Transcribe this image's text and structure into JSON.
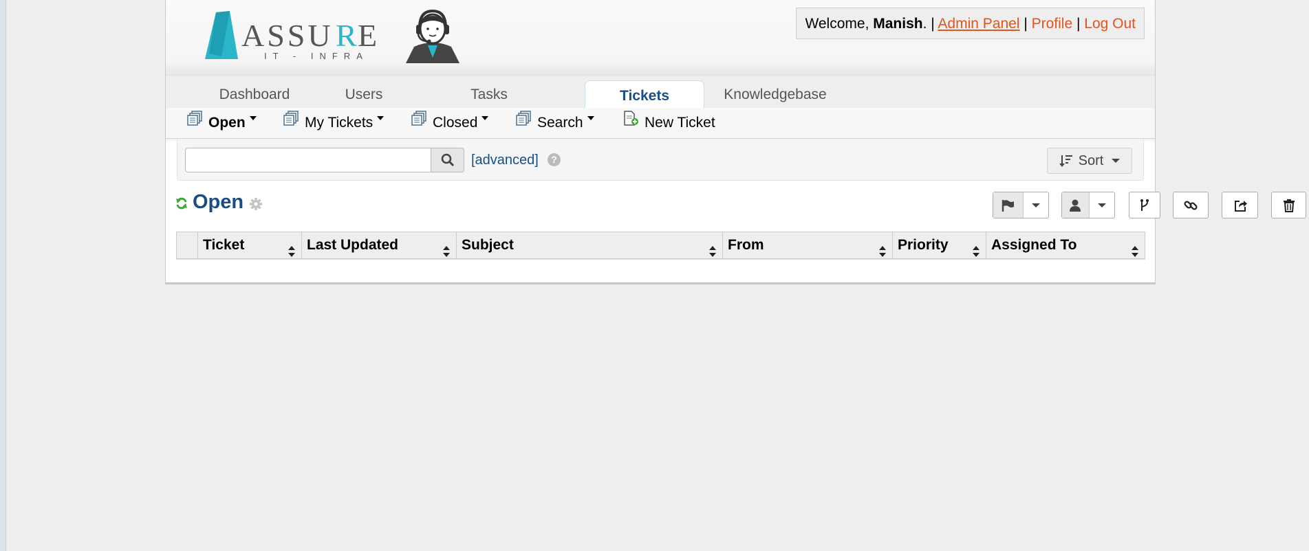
{
  "header": {
    "logo_text": "ASSURE",
    "logo_subtext": "IT - INFRA",
    "welcome_prefix": "Welcome, ",
    "user_name": "Manish",
    "welcome_suffix": ". | ",
    "admin_panel": "Admin Panel",
    "sep1": " | ",
    "profile": "Profile",
    "sep2": " | ",
    "logout": "Log Out"
  },
  "tabs": [
    {
      "label": "Dashboard",
      "active": false
    },
    {
      "label": "Users",
      "active": false
    },
    {
      "label": "Tasks",
      "active": false
    },
    {
      "label": "Tickets",
      "active": true
    },
    {
      "label": "Knowledgebase",
      "active": false
    }
  ],
  "subnav": [
    {
      "label": "Open",
      "icon": "tickets-icon",
      "dropdown": true,
      "bold": true
    },
    {
      "label": "My Tickets",
      "icon": "tickets-icon",
      "dropdown": true
    },
    {
      "label": "Closed",
      "icon": "tickets-icon",
      "dropdown": true
    },
    {
      "label": "Search",
      "icon": "tickets-icon",
      "dropdown": true
    },
    {
      "label": "New Ticket",
      "icon": "new-ticket-icon",
      "dropdown": false
    }
  ],
  "search": {
    "value": "",
    "placeholder": "",
    "advanced_label": "[advanced]",
    "help_glyph": "?",
    "sort_label": "Sort"
  },
  "queue": {
    "title": "Open"
  },
  "actions": [
    "flag-icon",
    "user-icon",
    "merge-icon",
    "link-icon",
    "transfer-icon",
    "trash-icon"
  ],
  "table": {
    "columns": [
      "Ticket",
      "Last Updated",
      "Subject",
      "From",
      "Priority",
      "Assigned To"
    ],
    "rows": []
  },
  "colors": {
    "brand_blue": "#184e81",
    "link_orange": "#e0541f",
    "logo_teal": "#2ab5c9",
    "refresh_green": "#3aaa35"
  }
}
